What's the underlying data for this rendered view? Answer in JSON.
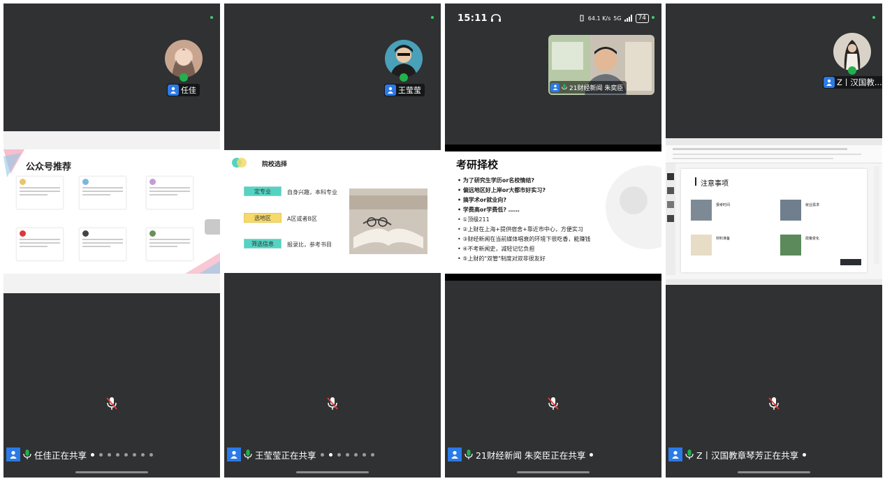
{
  "colors": {
    "panel_bg": "#2f3133",
    "accent_blue": "#2b7ae6",
    "mic_green": "#22b14c",
    "status_dot": "#3bd16f"
  },
  "panels": [
    {
      "speaker_name": "任佳",
      "sharing_text": "任佳正在共享",
      "slide": {
        "title": "公众号推荐"
      }
    },
    {
      "speaker_name": "王莹莹",
      "sharing_text": "王莹莹正在共享",
      "slide": {
        "title": "院校选择",
        "rows": [
          {
            "tag": "定专业",
            "desc": "自身兴趣，本科专业"
          },
          {
            "tag": "选地区",
            "desc": "A区或者B区"
          },
          {
            "tag": "筛选信息",
            "desc": "报录比，参考书目"
          }
        ]
      }
    },
    {
      "status_time": "15:11",
      "status_net": "64.1 K/s",
      "status_signal": "5G",
      "battery": "74",
      "speaker_name": "21财经新闻 朱奕臣",
      "sharing_text": "21财经新闻 朱奕臣正在共享",
      "slide": {
        "title": "考研择校",
        "items": [
          "为了研究生学历or名校情结?",
          "偏远地区好上岸or大都市好实习?",
          "搞学术or就业向?",
          "学费高or学费低? ……",
          "①顶级211",
          "②上财在上海+提供宿舍+靠近市中心，方便实习",
          "③财经新闻在当前媒体唱衰的环境下很吃香，能赚钱",
          "④不考新闻史，减轻记忆负担",
          "⑤上财的\"双管\"制度对双非很友好"
        ]
      }
    },
    {
      "speaker_name": "Z丨汉国教...",
      "sharing_text": "Z丨汉国教章琴芳正在共享",
      "slide": {
        "title": "注意事项",
        "cards": [
          {
            "label": "报考时间"
          },
          {
            "label": "就业需求"
          },
          {
            "label": "材料准备"
          },
          {
            "label": "政策变化"
          }
        ]
      }
    }
  ]
}
